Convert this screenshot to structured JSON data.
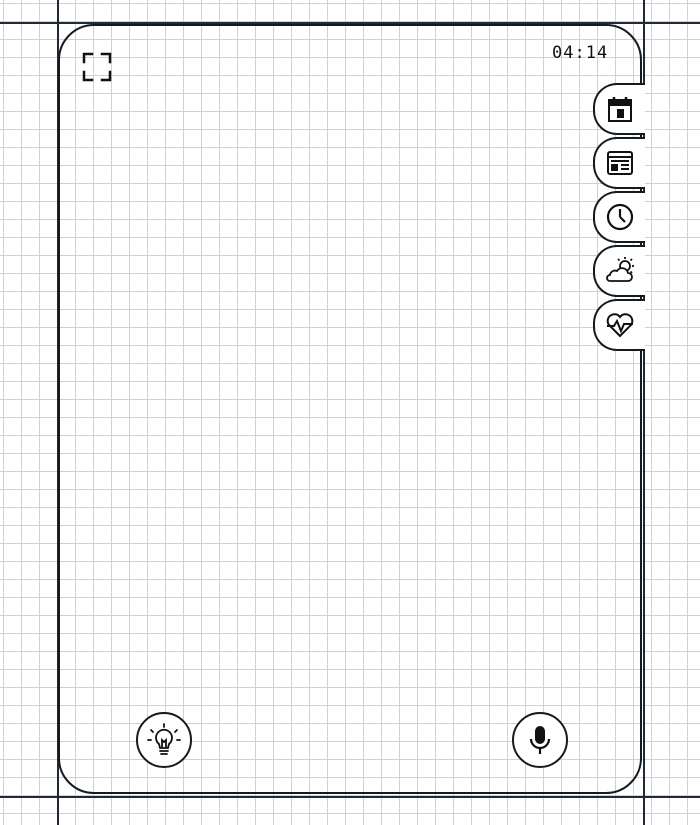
{
  "status_bar": {
    "time": "04:14"
  },
  "side_tabs": [
    {
      "icon": "calendar-icon"
    },
    {
      "icon": "news-icon"
    },
    {
      "icon": "clock-icon"
    },
    {
      "icon": "weather-icon"
    },
    {
      "icon": "health-icon"
    }
  ],
  "bottom_controls": {
    "left": {
      "icon": "lightbulb-icon"
    },
    "right": {
      "icon": "microphone-icon"
    }
  },
  "colors": {
    "ink": "#141a22",
    "grid": "#c9d3de",
    "paper": "#ffffff"
  }
}
